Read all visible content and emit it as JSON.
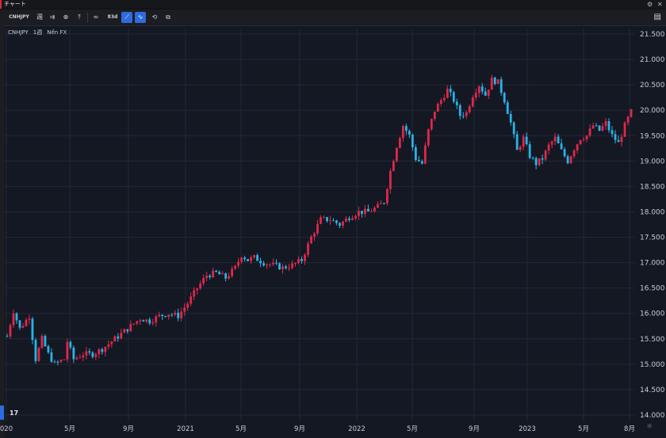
{
  "window": {
    "title": "チャート"
  },
  "toolbar": {
    "symbol": "CNHJPY",
    "interval": "週",
    "sep_label": "83d"
  },
  "legend": {
    "symbol": "CNHJPY",
    "interval": "1週",
    "source": "Nền FX"
  },
  "colors": {
    "up": "#e0284a",
    "down": "#2ab3e8",
    "background": "#141823",
    "grid": "#222839",
    "accent": "#2f6be0"
  },
  "chart_data": {
    "type": "candlestick",
    "title": "CNHJPY",
    "ylim": [
      14.0,
      21.5
    ],
    "grid": true,
    "y_ticks": [
      "21.500",
      "21.000",
      "20.500",
      "20.000",
      "19.500",
      "19.000",
      "18.500",
      "18.000",
      "17.500",
      "17.000",
      "16.500",
      "16.000",
      "15.500",
      "15.000",
      "14.500",
      "14.000"
    ],
    "x_ticks": [
      "020",
      "5月",
      "9月",
      "2021",
      "5月",
      "9月",
      "2022",
      "5月",
      "9月",
      "2023",
      "5月",
      "8月"
    ],
    "close_path": [
      {
        "w": 0,
        "c": 15.55
      },
      {
        "w": 2,
        "c": 16.05
      },
      {
        "w": 4,
        "c": 15.7
      },
      {
        "w": 7,
        "c": 15.95
      },
      {
        "w": 9,
        "c": 15.1
      },
      {
        "w": 11,
        "c": 15.5
      },
      {
        "w": 13,
        "c": 15.2
      },
      {
        "w": 15,
        "c": 15.0
      },
      {
        "w": 18,
        "c": 15.1
      },
      {
        "w": 19,
        "c": 15.45
      },
      {
        "w": 21,
        "c": 15.1
      },
      {
        "w": 24,
        "c": 15.2
      },
      {
        "w": 27,
        "c": 15.2
      },
      {
        "w": 30,
        "c": 15.3
      },
      {
        "w": 33,
        "c": 15.45
      },
      {
        "w": 36,
        "c": 15.6
      },
      {
        "w": 39,
        "c": 15.75
      },
      {
        "w": 42,
        "c": 15.9
      },
      {
        "w": 45,
        "c": 15.85
      },
      {
        "w": 48,
        "c": 15.95
      },
      {
        "w": 51,
        "c": 16.0
      },
      {
        "w": 54,
        "c": 15.95
      },
      {
        "w": 57,
        "c": 16.2
      },
      {
        "w": 60,
        "c": 16.5
      },
      {
        "w": 63,
        "c": 16.75
      },
      {
        "w": 66,
        "c": 16.8
      },
      {
        "w": 69,
        "c": 16.7
      },
      {
        "w": 72,
        "c": 16.9
      },
      {
        "w": 74,
        "c": 17.15
      },
      {
        "w": 76,
        "c": 17.05
      },
      {
        "w": 78,
        "c": 17.1
      },
      {
        "w": 81,
        "c": 17.0
      },
      {
        "w": 84,
        "c": 16.95
      },
      {
        "w": 87,
        "c": 16.9
      },
      {
        "w": 90,
        "c": 16.95
      },
      {
        "w": 93,
        "c": 17.05
      },
      {
        "w": 96,
        "c": 17.5
      },
      {
        "w": 99,
        "c": 17.85
      },
      {
        "w": 102,
        "c": 17.85
      },
      {
        "w": 105,
        "c": 17.75
      },
      {
        "w": 108,
        "c": 17.9
      },
      {
        "w": 111,
        "c": 18.0
      },
      {
        "w": 114,
        "c": 18.0
      },
      {
        "w": 117,
        "c": 18.1
      },
      {
        "w": 119,
        "c": 18.2
      },
      {
        "w": 121,
        "c": 18.8
      },
      {
        "w": 123,
        "c": 19.3
      },
      {
        "w": 125,
        "c": 19.7
      },
      {
        "w": 127,
        "c": 19.5
      },
      {
        "w": 129,
        "c": 19.05
      },
      {
        "w": 131,
        "c": 18.95
      },
      {
        "w": 133,
        "c": 19.6
      },
      {
        "w": 135,
        "c": 20.0
      },
      {
        "w": 137,
        "c": 20.2
      },
      {
        "w": 139,
        "c": 20.4
      },
      {
        "w": 141,
        "c": 20.2
      },
      {
        "w": 143,
        "c": 19.9
      },
      {
        "w": 145,
        "c": 19.95
      },
      {
        "w": 147,
        "c": 20.3
      },
      {
        "w": 149,
        "c": 20.5
      },
      {
        "w": 151,
        "c": 20.3
      },
      {
        "w": 153,
        "c": 20.6
      },
      {
        "w": 155,
        "c": 20.55
      },
      {
        "w": 157,
        "c": 20.2
      },
      {
        "w": 159,
        "c": 19.75
      },
      {
        "w": 161,
        "c": 19.2
      },
      {
        "w": 163,
        "c": 19.45
      },
      {
        "w": 165,
        "c": 19.1
      },
      {
        "w": 167,
        "c": 18.95
      },
      {
        "w": 169,
        "c": 19.05
      },
      {
        "w": 171,
        "c": 19.3
      },
      {
        "w": 173,
        "c": 19.45
      },
      {
        "w": 175,
        "c": 19.2
      },
      {
        "w": 177,
        "c": 19.0
      },
      {
        "w": 179,
        "c": 19.25
      },
      {
        "w": 181,
        "c": 19.45
      },
      {
        "w": 183,
        "c": 19.5
      },
      {
        "w": 185,
        "c": 19.7
      },
      {
        "w": 187,
        "c": 19.6
      },
      {
        "w": 189,
        "c": 19.75
      },
      {
        "w": 191,
        "c": 19.5
      },
      {
        "w": 193,
        "c": 19.35
      },
      {
        "w": 195,
        "c": 19.7
      },
      {
        "w": 197,
        "c": 19.97
      }
    ]
  }
}
